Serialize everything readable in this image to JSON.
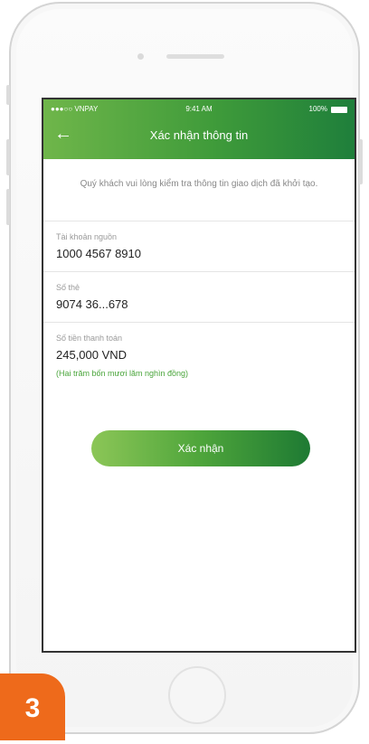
{
  "status_bar": {
    "carrier": "●●●○○ VNPAY",
    "time": "9:41 AM",
    "battery_pct": "100%"
  },
  "header": {
    "back_icon": "arrow-left-icon",
    "title": "Xác nhận thông tin"
  },
  "notice": "Quý khách vui lòng kiểm tra thông tin giao dịch đã khởi tạo.",
  "fields": [
    {
      "label": "Tài khoản nguồn",
      "value": "1000 4567 8910"
    },
    {
      "label": "Số thẻ",
      "value": "9074 36...678"
    },
    {
      "label": "Số tiền thanh toán",
      "value": "245,000 VND",
      "note": "(Hai trăm bốn mươi lăm nghìn đồng)"
    }
  ],
  "confirm_button": {
    "label": "Xác nhận"
  },
  "step_badge": "3",
  "colors": {
    "brand_green_light": "#6fb64a",
    "brand_green_dark": "#1f7f3b",
    "badge_orange": "#ee6a1b"
  }
}
